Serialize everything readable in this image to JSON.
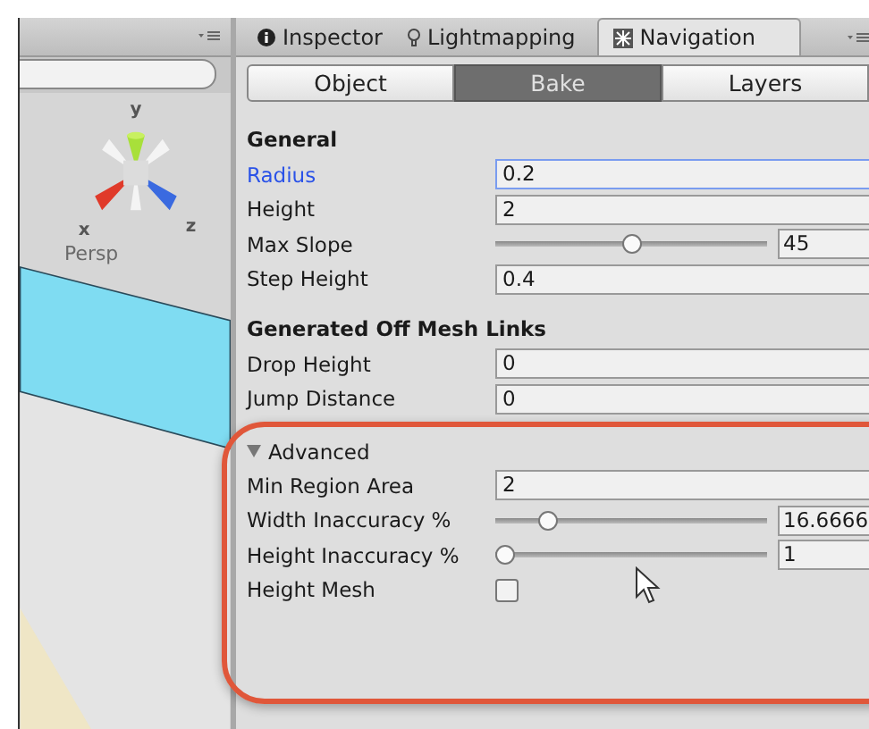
{
  "scene": {
    "axis_labels": [
      "y",
      "x",
      "z"
    ],
    "view_label": "Persp"
  },
  "tabs": [
    {
      "label": "Inspector",
      "selected": false
    },
    {
      "label": "Lightmapping",
      "selected": false
    },
    {
      "label": "Navigation",
      "selected": true
    }
  ],
  "modes": [
    {
      "label": "Object",
      "selected": false
    },
    {
      "label": "Bake",
      "selected": true
    },
    {
      "label": "Layers",
      "selected": false
    }
  ],
  "sections": [
    {
      "kind": "header",
      "title": "General",
      "rows": [
        {
          "kind": "field",
          "label": "Radius",
          "value": "0.2",
          "focused": true
        },
        {
          "kind": "field",
          "label": "Height",
          "value": "2",
          "focused": false
        },
        {
          "kind": "slider",
          "label": "Max Slope",
          "level": 0.5,
          "value": "45",
          "focused": false
        },
        {
          "kind": "field",
          "label": "Step Height",
          "value": "0.4",
          "focused": false
        }
      ]
    },
    {
      "kind": "header",
      "title": "Generated Off Mesh Links",
      "rows": [
        {
          "kind": "field",
          "label": "Drop Height",
          "value": "0",
          "focused": false
        },
        {
          "kind": "field",
          "label": "Jump Distance",
          "value": "0",
          "focused": false
        }
      ]
    },
    {
      "kind": "foldout",
      "title": "Advanced",
      "expanded": true,
      "rows": [
        {
          "kind": "field",
          "label": "Min Region Area",
          "value": "2",
          "focused": false
        },
        {
          "kind": "slider",
          "label": "Width Inaccuracy %",
          "level": 0.17,
          "value": "16.6666",
          "focused": false
        },
        {
          "kind": "slider",
          "label": "Height Inaccuracy %",
          "level": 0,
          "value": "1",
          "focused": false
        },
        {
          "kind": "checkbox",
          "label": "Height Mesh",
          "checked": false,
          "focused": false
        }
      ]
    }
  ]
}
